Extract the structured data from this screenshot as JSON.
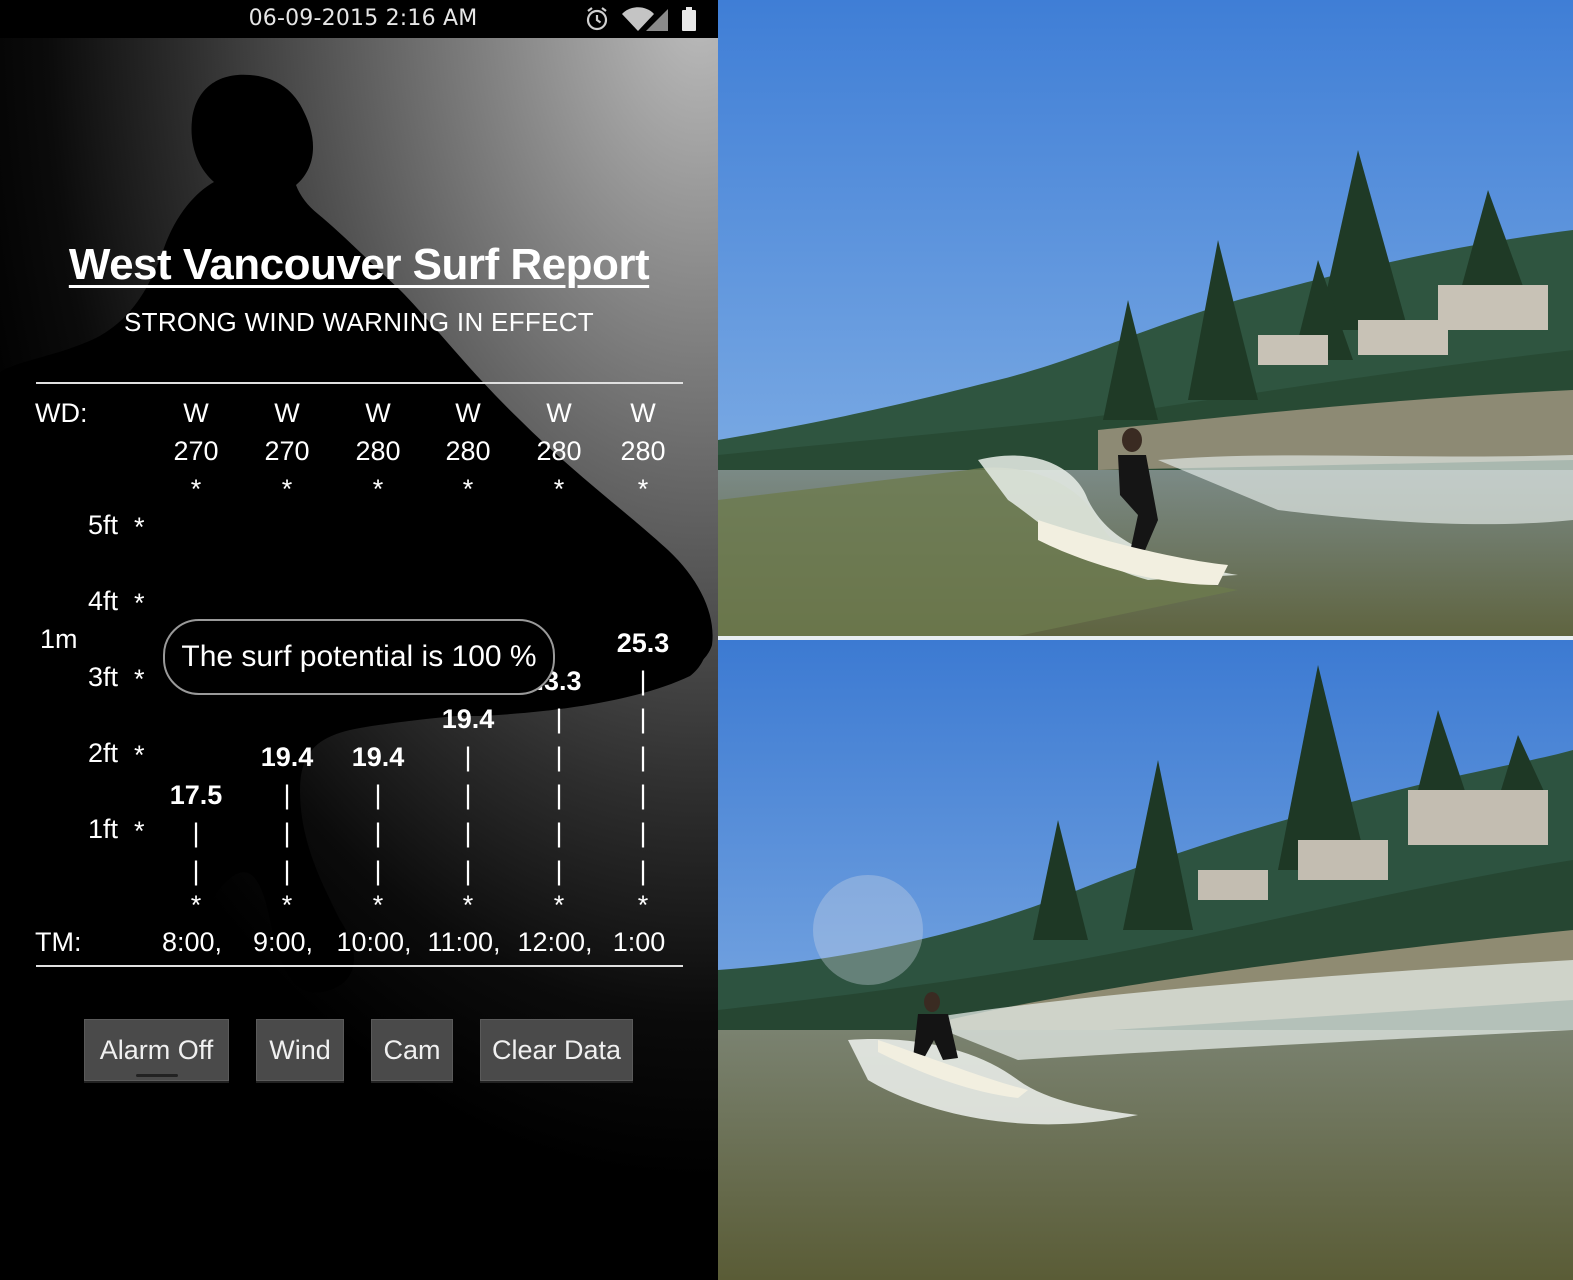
{
  "status_bar": {
    "datetime": "06-09-2015 2:16 AM",
    "icons": [
      "alarm-icon",
      "wifi-icon",
      "signal-icon",
      "battery-icon"
    ]
  },
  "report": {
    "title": "West Vancouver Surf Report",
    "warning": "STRONG WIND WARNING IN EFFECT",
    "wd_label": "WD:",
    "tm_label": "TM:",
    "meter_label": "1m",
    "axis_marker": "*",
    "height_labels": [
      "5ft",
      "4ft",
      "3ft",
      "2ft",
      "1ft"
    ],
    "columns": [
      {
        "dir": "W",
        "deg": "270",
        "value": "17.5",
        "time": "8:00,"
      },
      {
        "dir": "W",
        "deg": "270",
        "value": "19.4",
        "time": "9:00,"
      },
      {
        "dir": "W",
        "deg": "280",
        "value": "19.4",
        "time": "10:00,"
      },
      {
        "dir": "W",
        "deg": "280",
        "value": "19.4",
        "time": "11:00,"
      },
      {
        "dir": "W",
        "deg": "280",
        "value": ".3.3",
        "time": "12:00,"
      },
      {
        "dir": "W",
        "deg": "280",
        "value": "25.3",
        "time": "1:00"
      }
    ],
    "toast": "The surf potential is 100 %"
  },
  "buttons": {
    "alarm": "Alarm Off",
    "wind": "Wind",
    "cam": "Cam",
    "clear": "Clear Data"
  },
  "chart_data": {
    "type": "bar",
    "title": "West Vancouver Surf Report",
    "categories": [
      "8:00",
      "9:00",
      "10:00",
      "11:00",
      "12:00",
      "1:00"
    ],
    "series": [
      {
        "values": [
          17.5,
          19.4,
          19.4,
          19.4,
          23.3,
          25.3
        ]
      }
    ],
    "wind_direction": [
      "W 270",
      "W 270",
      "W 280",
      "W 280",
      "W 280",
      "W 280"
    ],
    "y_tick_labels": [
      "1ft",
      "2ft",
      "3ft",
      "1m",
      "4ft",
      "5ft"
    ]
  }
}
